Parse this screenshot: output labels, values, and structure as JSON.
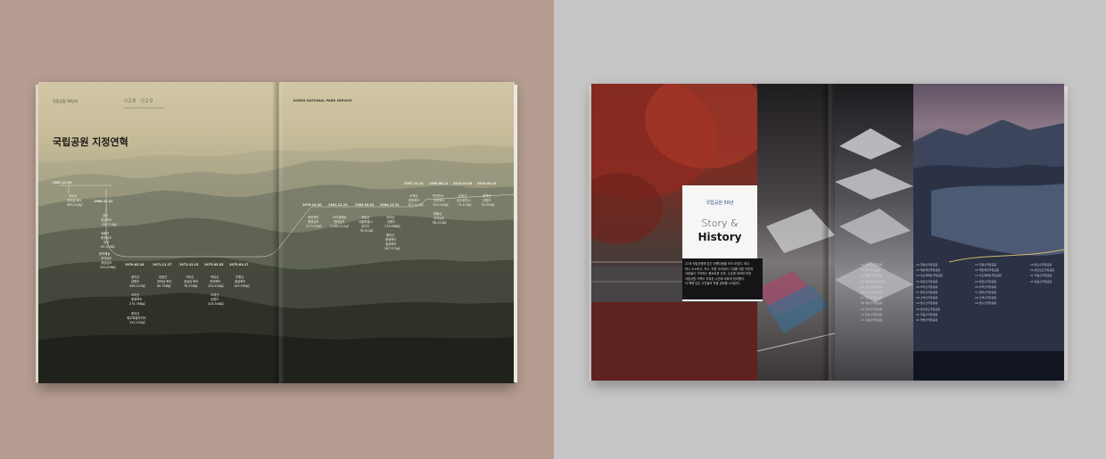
{
  "left_book": {
    "running_head_left": "국립공원 50년사",
    "page_left": "028",
    "page_right": "029",
    "page_sub": "KOREA NATIONAL PARK SERVICE",
    "running_head_right": "KOREA NATIONAL PARK SERVICE",
    "title": "국립공원 지정연혁",
    "timeline": [
      {
        "date": "1967.12.29",
        "lines": [
          "지리산",
          "전라남·북도",
          "483.022㎢"
        ]
      },
      {
        "date": "1968.12.31",
        "lines": [
          "경주",
          "경상북도",
          "138.715㎢"
        ]
      },
      {
        "date": "",
        "lines": [
          "계룡산",
          "충청남도",
          "대전",
          "65.335㎢"
        ]
      },
      {
        "date": "",
        "lines": [
          "한려해상",
          "전라남도",
          "경상남도",
          "535.676㎢"
        ]
      },
      {
        "date": "1970.03.24",
        "lines": [
          "설악산",
          "강원도",
          "398.237㎢"
        ]
      },
      {
        "date": "",
        "lines": [
          "속리산",
          "충청북도",
          "274.766㎢"
        ]
      },
      {
        "date": "",
        "lines": [
          "한라산",
          "제주특별자치도",
          "153.332㎢"
        ]
      },
      {
        "date": "1971.11.17",
        "lines": [
          "내장산",
          "전라남·북도",
          "80.708㎢"
        ]
      },
      {
        "date": "1971.12.13",
        "lines": [
          "가야산",
          "경상남·북도",
          "76.256㎢"
        ]
      },
      {
        "date": "1973.03.25",
        "lines": [
          "덕유산",
          "전라북도",
          "229.430㎢"
        ]
      },
      {
        "date": "",
        "lines": [
          "오대산",
          "강원도",
          "326.348㎢"
        ]
      },
      {
        "date": "1975.03.17",
        "lines": [
          "주왕산",
          "경상북도",
          "105.595㎢"
        ]
      },
      {
        "date": "1976.10.30",
        "lines": [
          "태안해안",
          "충청남도",
          "377.019㎢"
        ]
      },
      {
        "date": "1981.12.23",
        "lines": [
          "다도해해상",
          "전라남도",
          "2,266.221㎢"
        ]
      },
      {
        "date": "1983.06.02",
        "lines": [
          "북한산",
          "서울특별시",
          "경기도",
          "76.922㎢"
        ]
      },
      {
        "date": "1984.12.31",
        "lines": [
          "치악산",
          "강원도",
          "175.668㎢"
        ]
      },
      {
        "date": "",
        "lines": [
          "월악산",
          "충청북도",
          "경상북도",
          "287.571㎢"
        ]
      },
      {
        "date": "1987.12.14",
        "lines": [
          "소백산",
          "충청북도",
          "322.011㎢"
        ]
      },
      {
        "date": "",
        "lines": [
          "월출산",
          "전라남도",
          "56.220㎢"
        ]
      },
      {
        "date": "1988.06.11",
        "lines": [
          "변산반도",
          "전라북도",
          "153.934㎢"
        ]
      },
      {
        "date": "2013.03.04",
        "lines": [
          "무등산",
          "광주광역시",
          "75.425㎢"
        ]
      },
      {
        "date": "2016.08.22",
        "lines": [
          "태백산",
          "강원도",
          "70.052㎢"
        ]
      }
    ]
  },
  "right_book": {
    "badge": "국립공원 50년",
    "story_line1": "Story &",
    "story_line2": "History",
    "body_lines": [
      "22개 국립공원에 담긴 아름다움을 모아 보았다. 하나",
      "하나 소소하고, 작고, 또한 우리네의 그대를 이룬 자연과",
      "사람들이 기억하는 풍요로운 산하, 수호에 대하여 또한",
      "국립공원 가족이 지켜온 시간에 대하여 정리했다.",
      "이 책에 담긴 사진들의 작품 경로를 소개한다."
    ],
    "index_col1": [
      "01 지리산국립공원",
      "02 경주국립공원",
      "03 계룡산국립공원",
      "04 한려해상국립공원",
      "05 설악산국립공원",
      "06 속리산국립공원",
      "07 한라산국립공원",
      "08 내장산국립공원",
      "09 가야산국립공원",
      "10 덕유산국립공원",
      "11 오대산국립공원"
    ],
    "index_col2": [
      "12 주왕산국립공원",
      "13 태안해안국립공원",
      "14 다도해해상국립공원",
      "15 북한산국립공원",
      "16 치악산국립공원",
      "17 월악산국립공원",
      "18 소백산국립공원",
      "19 월출산국립공원",
      "20 변산반도국립공원",
      "21 무등산국립공원",
      "22 태백산국립공원"
    ],
    "index_col3": [
      "23 팔공산국립공원"
    ]
  },
  "colors": {
    "left_background": "#b69d91",
    "right_background": "#c6c6c6",
    "card_accent": "#2a4b8c"
  }
}
